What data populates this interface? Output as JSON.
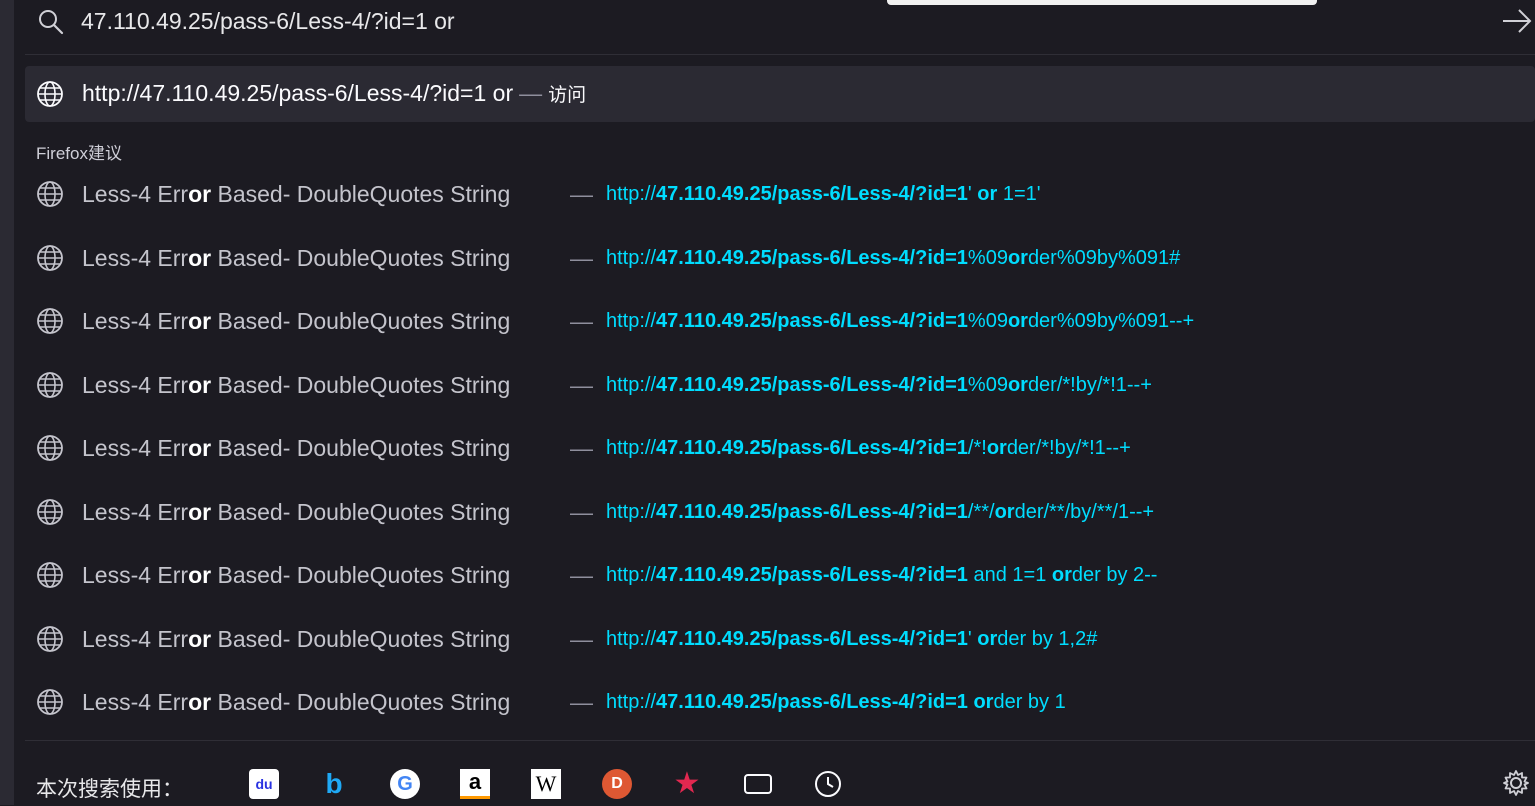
{
  "urlbar": {
    "value": "47.110.49.25/pass-6/Less-4/?id=1 or",
    "visit_url": "http://47.110.49.25/pass-6/Less-4/?id=1 or",
    "visit_dash": "—",
    "visit_label": "访问"
  },
  "suggestions": {
    "group_label": "Firefox建议",
    "dash": "—",
    "items": [
      {
        "title_pre": "Less-4 Err",
        "title_bold": "or",
        "title_post": " Based- DoubleQuotes String",
        "url_plain1": "http://",
        "url_bold1": "47.110.49.25/pass-6/Less-4/?id=1",
        "url_plain2": "' ",
        "url_bold2": "or",
        "url_plain3": " 1=1'"
      },
      {
        "title_pre": "Less-4 Err",
        "title_bold": "or",
        "title_post": " Based- DoubleQuotes String",
        "url_plain1": "http://",
        "url_bold1": "47.110.49.25/pass-6/Less-4/?id=1",
        "url_plain2": "%09",
        "url_bold2": "or",
        "url_plain3": "der%09by%091#"
      },
      {
        "title_pre": "Less-4 Err",
        "title_bold": "or",
        "title_post": " Based- DoubleQuotes String",
        "url_plain1": "http://",
        "url_bold1": "47.110.49.25/pass-6/Less-4/?id=1",
        "url_plain2": "%09",
        "url_bold2": "or",
        "url_plain3": "der%09by%091--+"
      },
      {
        "title_pre": "Less-4 Err",
        "title_bold": "or",
        "title_post": " Based- DoubleQuotes String",
        "url_plain1": "http://",
        "url_bold1": "47.110.49.25/pass-6/Less-4/?id=1",
        "url_plain2": "%09",
        "url_bold2": "or",
        "url_plain3": "der/*!by/*!1--+"
      },
      {
        "title_pre": "Less-4 Err",
        "title_bold": "or",
        "title_post": " Based- DoubleQuotes String",
        "url_plain1": "http://",
        "url_bold1": "47.110.49.25/pass-6/Less-4/?id=1",
        "url_plain2": "/*!",
        "url_bold2": "or",
        "url_plain3": "der/*!by/*!1--+"
      },
      {
        "title_pre": "Less-4 Err",
        "title_bold": "or",
        "title_post": " Based- DoubleQuotes String",
        "url_plain1": "http://",
        "url_bold1": "47.110.49.25/pass-6/Less-4/?id=1",
        "url_plain2": "/**/",
        "url_bold2": "or",
        "url_plain3": "der/**/by/**/1--+"
      },
      {
        "title_pre": "Less-4 Err",
        "title_bold": "or",
        "title_post": " Based- DoubleQuotes String",
        "url_plain1": "http://",
        "url_bold1": "47.110.49.25/pass-6/Less-4/?id=1",
        "url_plain2": " and 1=1 ",
        "url_bold2": "or",
        "url_plain3": "der by 2--"
      },
      {
        "title_pre": "Less-4 Err",
        "title_bold": "or",
        "title_post": " Based- DoubleQuotes String",
        "url_plain1": "http://",
        "url_bold1": "47.110.49.25/pass-6/Less-4/?id=1",
        "url_plain2": "' ",
        "url_bold2": "or",
        "url_plain3": "der by 1,2#"
      },
      {
        "title_pre": "Less-4 Err",
        "title_bold": "or",
        "title_post": " Based- DoubleQuotes String",
        "url_plain1": "http://",
        "url_bold1": "47.110.49.25/pass-6/Less-4/?id=1",
        "url_plain2": " ",
        "url_bold2": "or",
        "url_plain3": "der by 1"
      }
    ]
  },
  "search_engines": {
    "label": "本次搜索使用：",
    "engines": [
      {
        "icon": "baidu-icon",
        "letter": "du",
        "color": "#2932e1"
      },
      {
        "icon": "bing-icon",
        "letter": "b",
        "color": "#1fa9f5"
      },
      {
        "icon": "google-icon",
        "letter": "G",
        "color": "#4285f4"
      },
      {
        "icon": "amazon-icon",
        "letter": "a",
        "color": "#ff9900"
      },
      {
        "icon": "wikipedia-icon",
        "letter": "W",
        "color": "#000000"
      },
      {
        "icon": "duckduckgo-icon",
        "letter": "D",
        "color": "#de5833"
      },
      {
        "icon": "bookmarks-star-icon",
        "letter": "★",
        "color": "#e22850"
      },
      {
        "icon": "tabs-icon",
        "letter": "",
        "color": "#fbfbfe"
      },
      {
        "icon": "history-clock-icon",
        "letter": "",
        "color": "#fbfbfe"
      }
    ]
  },
  "colors": {
    "background": "#1c1b22",
    "selected_row": "#2b2a33",
    "url_accent": "#00ddff",
    "text": "#fbfbfe"
  }
}
